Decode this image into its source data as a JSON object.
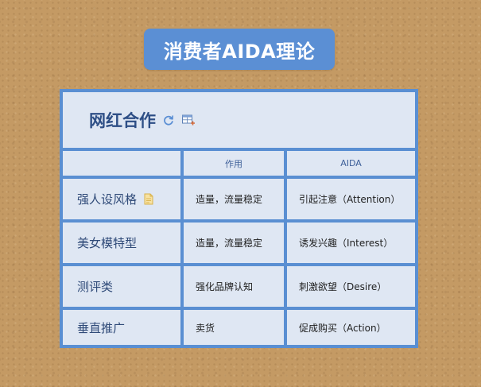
{
  "title": "消费者AIDA理论",
  "table": {
    "header": "网红合作",
    "columns": [
      "",
      "作用",
      "AIDA"
    ],
    "rows": [
      {
        "label": "强人设风格",
        "effect": "造量，流量稳定",
        "aida": "引起注意（Attention）",
        "has_note": true
      },
      {
        "label": "美女模特型",
        "effect": "造量，流量稳定",
        "aida": "诱发兴趣（Interest）"
      },
      {
        "label": "测评类",
        "effect": "强化品牌认知",
        "aida": "刺激欲望（Desire）"
      },
      {
        "label": "垂直推广",
        "effect": "卖货",
        "aida": "促成购买（Action）"
      }
    ]
  },
  "icons": {
    "header_icons": [
      "refresh-icon",
      "insert-table-icon"
    ],
    "row_note": "note-icon"
  },
  "colors": {
    "accent": "#5b8fd4",
    "cell_bg": "#dfe7f3",
    "header_text": "#2e4f86",
    "background": "#c49a64"
  }
}
